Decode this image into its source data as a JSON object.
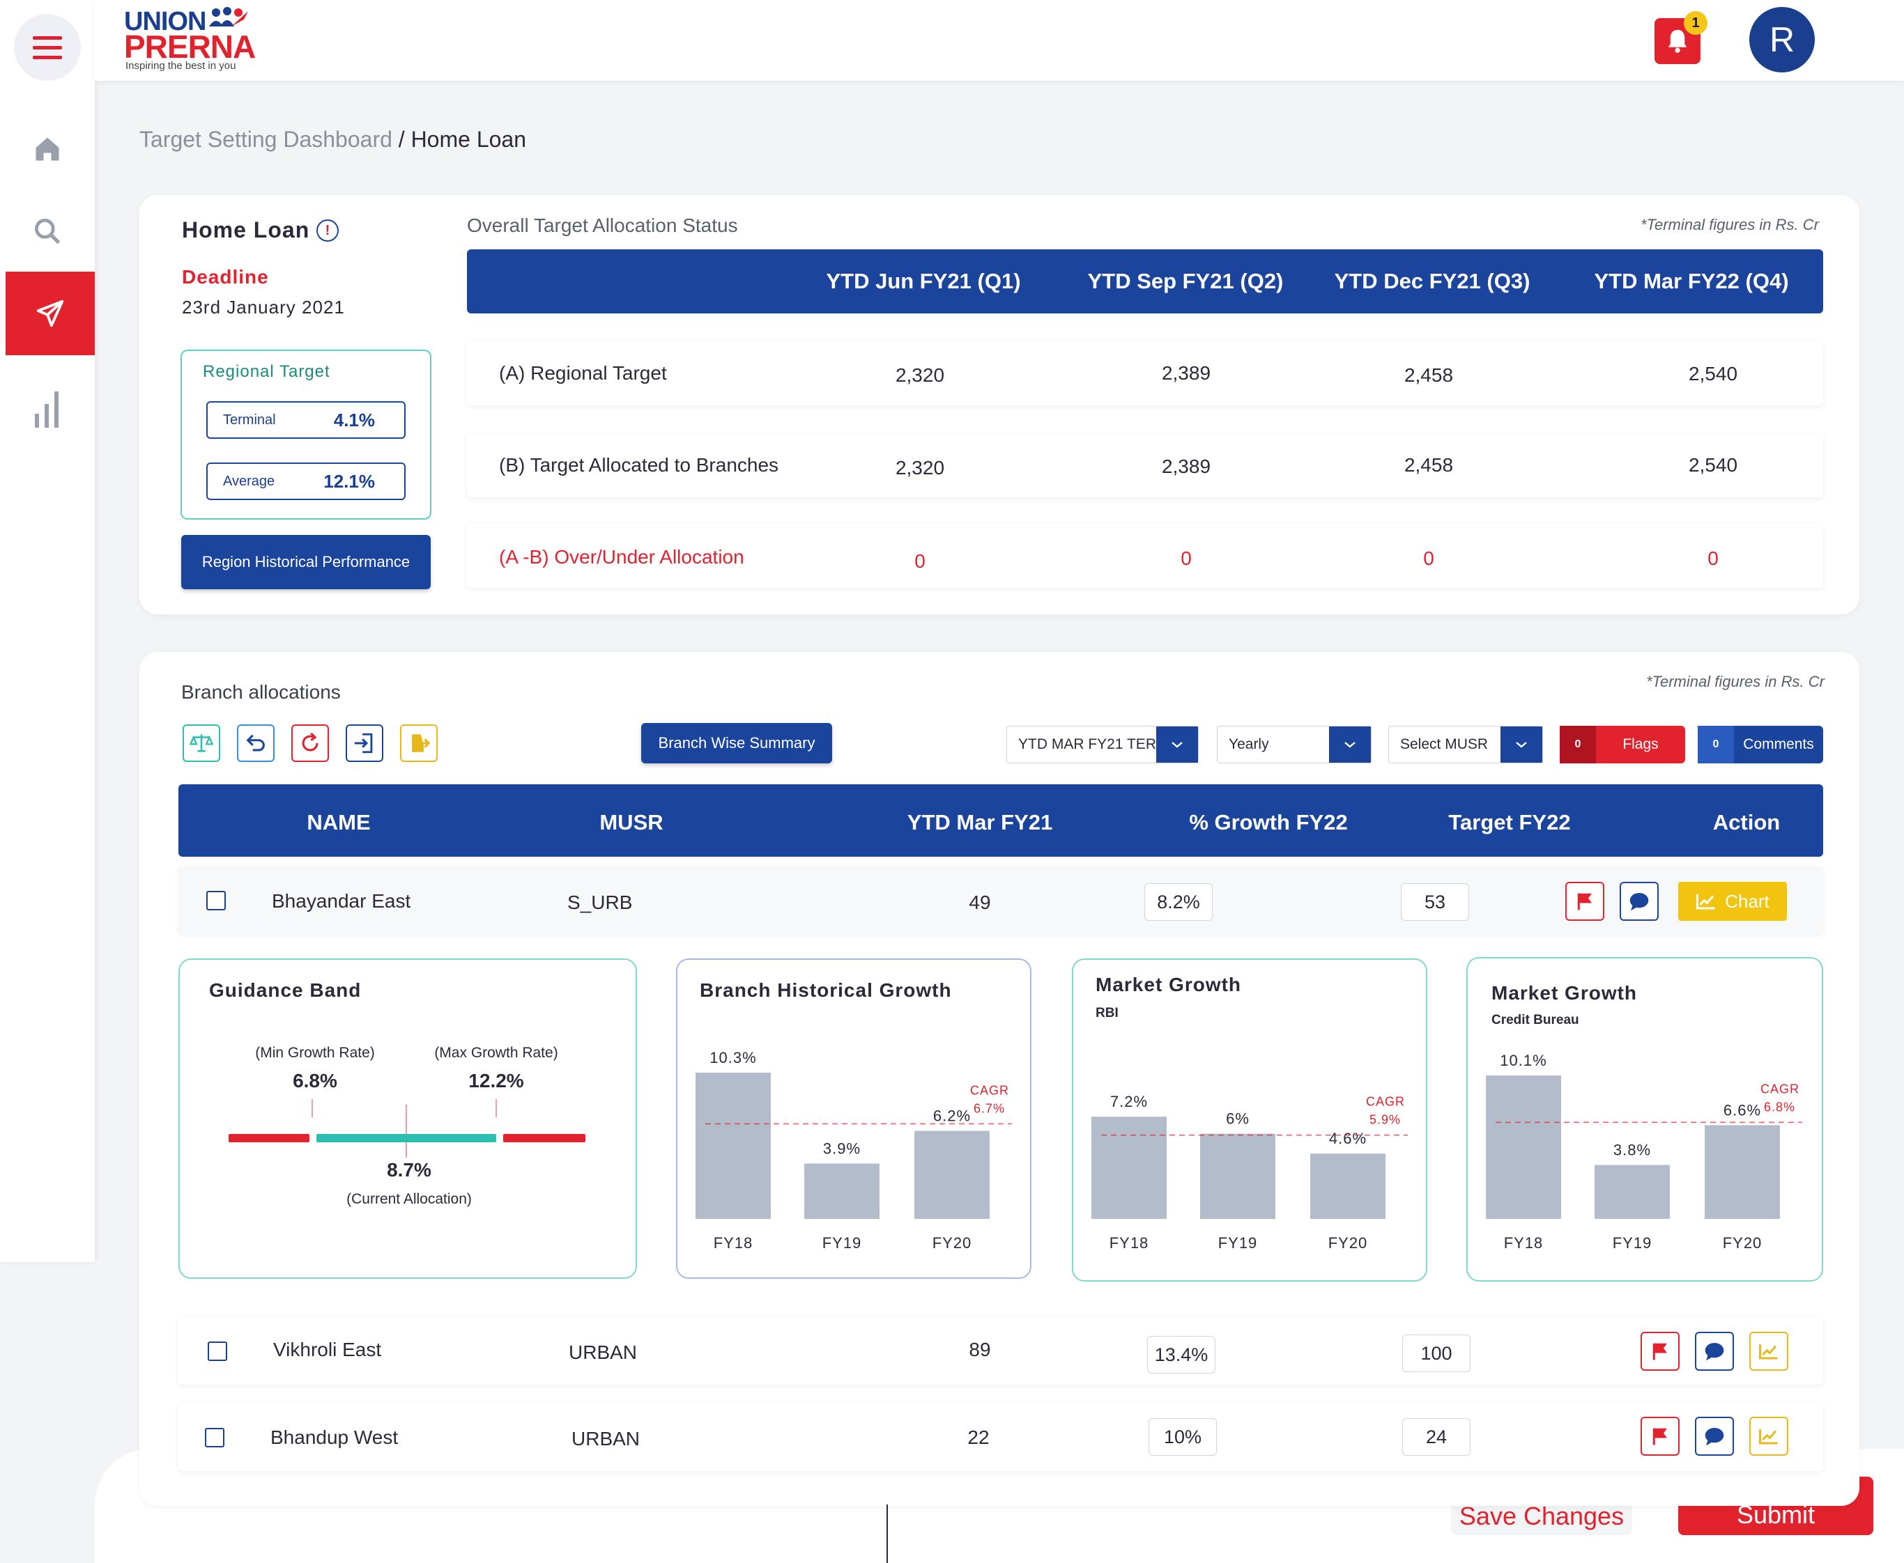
{
  "brand": {
    "line1": "UNION",
    "line2": "PRERNA",
    "tagline": "Inspiring the best in you"
  },
  "header": {
    "notification_count": "1",
    "avatar_initial": "R"
  },
  "breadcrumb": {
    "parent": "Target Setting Dashboard",
    "separator": " / ",
    "current": "Home Loan"
  },
  "summary": {
    "title": "Home Loan",
    "deadline_label": "Deadline",
    "deadline_date": "23rd January 2021",
    "regional_target": {
      "label": "Regional Target",
      "terminal_label": "Terminal",
      "terminal_value": "4.1%",
      "average_label": "Average",
      "average_value": "12.1%"
    },
    "history_button": "Region Historical Performance",
    "status_title": "Overall Target Allocation Status",
    "note": "*Terminal figures in Rs. Cr",
    "columns": [
      "YTD Jun FY21 (Q1)",
      "YTD Sep FY21 (Q2)",
      "YTD Dec FY21 (Q3)",
      "YTD Mar FY22 (Q4)"
    ],
    "rows": [
      {
        "label": "(A) Regional Target",
        "values": [
          "2,320",
          "2,389",
          "2,458",
          "2,540"
        ]
      },
      {
        "label": "(B) Target Allocated to Branches",
        "values": [
          "2,320",
          "2,389",
          "2,458",
          "2,540"
        ]
      },
      {
        "label": "(A -B) Over/Under Allocation",
        "values": [
          "0",
          "0",
          "0",
          "0"
        ]
      }
    ]
  },
  "branches": {
    "title": "Branch allocations",
    "note": "*Terminal figures in Rs. Cr",
    "summary_button": "Branch Wise Summary",
    "filters": {
      "period": "YTD MAR FY21 TER",
      "frequency": "Yearly",
      "musr": "Select MUSR"
    },
    "flags": {
      "count": "0",
      "label": "Flags"
    },
    "comments": {
      "count": "0",
      "label": "Comments"
    },
    "columns": [
      "NAME",
      "MUSR",
      "YTD Mar FY21",
      "% Growth FY22",
      "Target FY22",
      "Action"
    ],
    "chart_button": "Chart",
    "rows": [
      {
        "name": "Bhayandar East",
        "musr": "S_URB",
        "ytd": "49",
        "growth": "8.2%",
        "target": "53"
      },
      {
        "name": "Vikhroli East",
        "musr": "URBAN",
        "ytd": "89",
        "growth": "13.4%",
        "target": "100"
      },
      {
        "name": "Bhandup West",
        "musr": "URBAN",
        "ytd": "22",
        "growth": "10%",
        "target": "24"
      }
    ]
  },
  "guidance": {
    "title": "Guidance Band",
    "min_label": "(Min Growth Rate)",
    "min_value": "6.8%",
    "max_label": "(Max Growth Rate)",
    "max_value": "12.2%",
    "current_value": "8.7%",
    "current_label": "(Current Allocation)"
  },
  "chart_data": [
    {
      "type": "bar",
      "title": "Branch Historical Growth",
      "categories": [
        "FY18",
        "FY19",
        "FY20"
      ],
      "values": [
        10.3,
        3.9,
        6.2
      ],
      "value_labels": [
        "10.3%",
        "3.9%",
        "6.2%"
      ],
      "cagr_label": "CAGR",
      "cagr_text": "6.7%",
      "cagr": 6.7
    },
    {
      "type": "bar",
      "title": "Market Growth",
      "subtitle": "RBI",
      "categories": [
        "FY18",
        "FY19",
        "FY20"
      ],
      "values": [
        7.2,
        6,
        4.6
      ],
      "value_labels": [
        "7.2%",
        "6%",
        "4.6%"
      ],
      "cagr_label": "CAGR",
      "cagr_text": "5.9%",
      "cagr": 5.9
    },
    {
      "type": "bar",
      "title": "Market Growth",
      "subtitle": "Credit Bureau",
      "categories": [
        "FY18",
        "FY19",
        "FY20"
      ],
      "values": [
        10.1,
        3.8,
        6.6
      ],
      "value_labels": [
        "10.1%",
        "3.8%",
        "6.6%"
      ],
      "cagr_label": "CAGR",
      "cagr_text": "6.8%",
      "cagr": 6.8
    }
  ],
  "footer": {
    "save_label": "Save Changes",
    "submit_label": "Submit"
  },
  "colors": {
    "primary": "#1b449c",
    "accent": "#e2222d",
    "teal": "#2bbfb0",
    "bar": "#b3bccb",
    "yellow": "#f1c40f"
  }
}
